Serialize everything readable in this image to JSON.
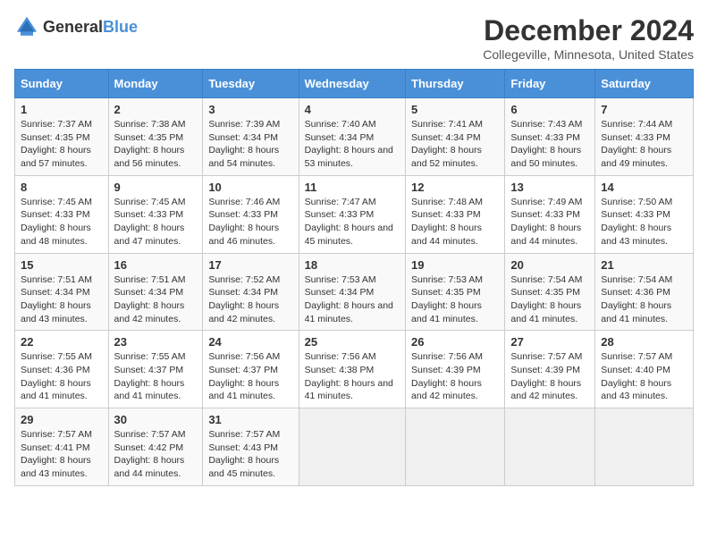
{
  "logo": {
    "text_general": "General",
    "text_blue": "Blue"
  },
  "title": "December 2024",
  "subtitle": "Collegeville, Minnesota, United States",
  "days_of_week": [
    "Sunday",
    "Monday",
    "Tuesday",
    "Wednesday",
    "Thursday",
    "Friday",
    "Saturday"
  ],
  "weeks": [
    [
      {
        "day": "1",
        "sunrise": "Sunrise: 7:37 AM",
        "sunset": "Sunset: 4:35 PM",
        "daylight": "Daylight: 8 hours and 57 minutes."
      },
      {
        "day": "2",
        "sunrise": "Sunrise: 7:38 AM",
        "sunset": "Sunset: 4:35 PM",
        "daylight": "Daylight: 8 hours and 56 minutes."
      },
      {
        "day": "3",
        "sunrise": "Sunrise: 7:39 AM",
        "sunset": "Sunset: 4:34 PM",
        "daylight": "Daylight: 8 hours and 54 minutes."
      },
      {
        "day": "4",
        "sunrise": "Sunrise: 7:40 AM",
        "sunset": "Sunset: 4:34 PM",
        "daylight": "Daylight: 8 hours and 53 minutes."
      },
      {
        "day": "5",
        "sunrise": "Sunrise: 7:41 AM",
        "sunset": "Sunset: 4:34 PM",
        "daylight": "Daylight: 8 hours and 52 minutes."
      },
      {
        "day": "6",
        "sunrise": "Sunrise: 7:43 AM",
        "sunset": "Sunset: 4:33 PM",
        "daylight": "Daylight: 8 hours and 50 minutes."
      },
      {
        "day": "7",
        "sunrise": "Sunrise: 7:44 AM",
        "sunset": "Sunset: 4:33 PM",
        "daylight": "Daylight: 8 hours and 49 minutes."
      }
    ],
    [
      {
        "day": "8",
        "sunrise": "Sunrise: 7:45 AM",
        "sunset": "Sunset: 4:33 PM",
        "daylight": "Daylight: 8 hours and 48 minutes."
      },
      {
        "day": "9",
        "sunrise": "Sunrise: 7:45 AM",
        "sunset": "Sunset: 4:33 PM",
        "daylight": "Daylight: 8 hours and 47 minutes."
      },
      {
        "day": "10",
        "sunrise": "Sunrise: 7:46 AM",
        "sunset": "Sunset: 4:33 PM",
        "daylight": "Daylight: 8 hours and 46 minutes."
      },
      {
        "day": "11",
        "sunrise": "Sunrise: 7:47 AM",
        "sunset": "Sunset: 4:33 PM",
        "daylight": "Daylight: 8 hours and 45 minutes."
      },
      {
        "day": "12",
        "sunrise": "Sunrise: 7:48 AM",
        "sunset": "Sunset: 4:33 PM",
        "daylight": "Daylight: 8 hours and 44 minutes."
      },
      {
        "day": "13",
        "sunrise": "Sunrise: 7:49 AM",
        "sunset": "Sunset: 4:33 PM",
        "daylight": "Daylight: 8 hours and 44 minutes."
      },
      {
        "day": "14",
        "sunrise": "Sunrise: 7:50 AM",
        "sunset": "Sunset: 4:33 PM",
        "daylight": "Daylight: 8 hours and 43 minutes."
      }
    ],
    [
      {
        "day": "15",
        "sunrise": "Sunrise: 7:51 AM",
        "sunset": "Sunset: 4:34 PM",
        "daylight": "Daylight: 8 hours and 43 minutes."
      },
      {
        "day": "16",
        "sunrise": "Sunrise: 7:51 AM",
        "sunset": "Sunset: 4:34 PM",
        "daylight": "Daylight: 8 hours and 42 minutes."
      },
      {
        "day": "17",
        "sunrise": "Sunrise: 7:52 AM",
        "sunset": "Sunset: 4:34 PM",
        "daylight": "Daylight: 8 hours and 42 minutes."
      },
      {
        "day": "18",
        "sunrise": "Sunrise: 7:53 AM",
        "sunset": "Sunset: 4:34 PM",
        "daylight": "Daylight: 8 hours and 41 minutes."
      },
      {
        "day": "19",
        "sunrise": "Sunrise: 7:53 AM",
        "sunset": "Sunset: 4:35 PM",
        "daylight": "Daylight: 8 hours and 41 minutes."
      },
      {
        "day": "20",
        "sunrise": "Sunrise: 7:54 AM",
        "sunset": "Sunset: 4:35 PM",
        "daylight": "Daylight: 8 hours and 41 minutes."
      },
      {
        "day": "21",
        "sunrise": "Sunrise: 7:54 AM",
        "sunset": "Sunset: 4:36 PM",
        "daylight": "Daylight: 8 hours and 41 minutes."
      }
    ],
    [
      {
        "day": "22",
        "sunrise": "Sunrise: 7:55 AM",
        "sunset": "Sunset: 4:36 PM",
        "daylight": "Daylight: 8 hours and 41 minutes."
      },
      {
        "day": "23",
        "sunrise": "Sunrise: 7:55 AM",
        "sunset": "Sunset: 4:37 PM",
        "daylight": "Daylight: 8 hours and 41 minutes."
      },
      {
        "day": "24",
        "sunrise": "Sunrise: 7:56 AM",
        "sunset": "Sunset: 4:37 PM",
        "daylight": "Daylight: 8 hours and 41 minutes."
      },
      {
        "day": "25",
        "sunrise": "Sunrise: 7:56 AM",
        "sunset": "Sunset: 4:38 PM",
        "daylight": "Daylight: 8 hours and 41 minutes."
      },
      {
        "day": "26",
        "sunrise": "Sunrise: 7:56 AM",
        "sunset": "Sunset: 4:39 PM",
        "daylight": "Daylight: 8 hours and 42 minutes."
      },
      {
        "day": "27",
        "sunrise": "Sunrise: 7:57 AM",
        "sunset": "Sunset: 4:39 PM",
        "daylight": "Daylight: 8 hours and 42 minutes."
      },
      {
        "day": "28",
        "sunrise": "Sunrise: 7:57 AM",
        "sunset": "Sunset: 4:40 PM",
        "daylight": "Daylight: 8 hours and 43 minutes."
      }
    ],
    [
      {
        "day": "29",
        "sunrise": "Sunrise: 7:57 AM",
        "sunset": "Sunset: 4:41 PM",
        "daylight": "Daylight: 8 hours and 43 minutes."
      },
      {
        "day": "30",
        "sunrise": "Sunrise: 7:57 AM",
        "sunset": "Sunset: 4:42 PM",
        "daylight": "Daylight: 8 hours and 44 minutes."
      },
      {
        "day": "31",
        "sunrise": "Sunrise: 7:57 AM",
        "sunset": "Sunset: 4:43 PM",
        "daylight": "Daylight: 8 hours and 45 minutes."
      },
      null,
      null,
      null,
      null
    ]
  ]
}
